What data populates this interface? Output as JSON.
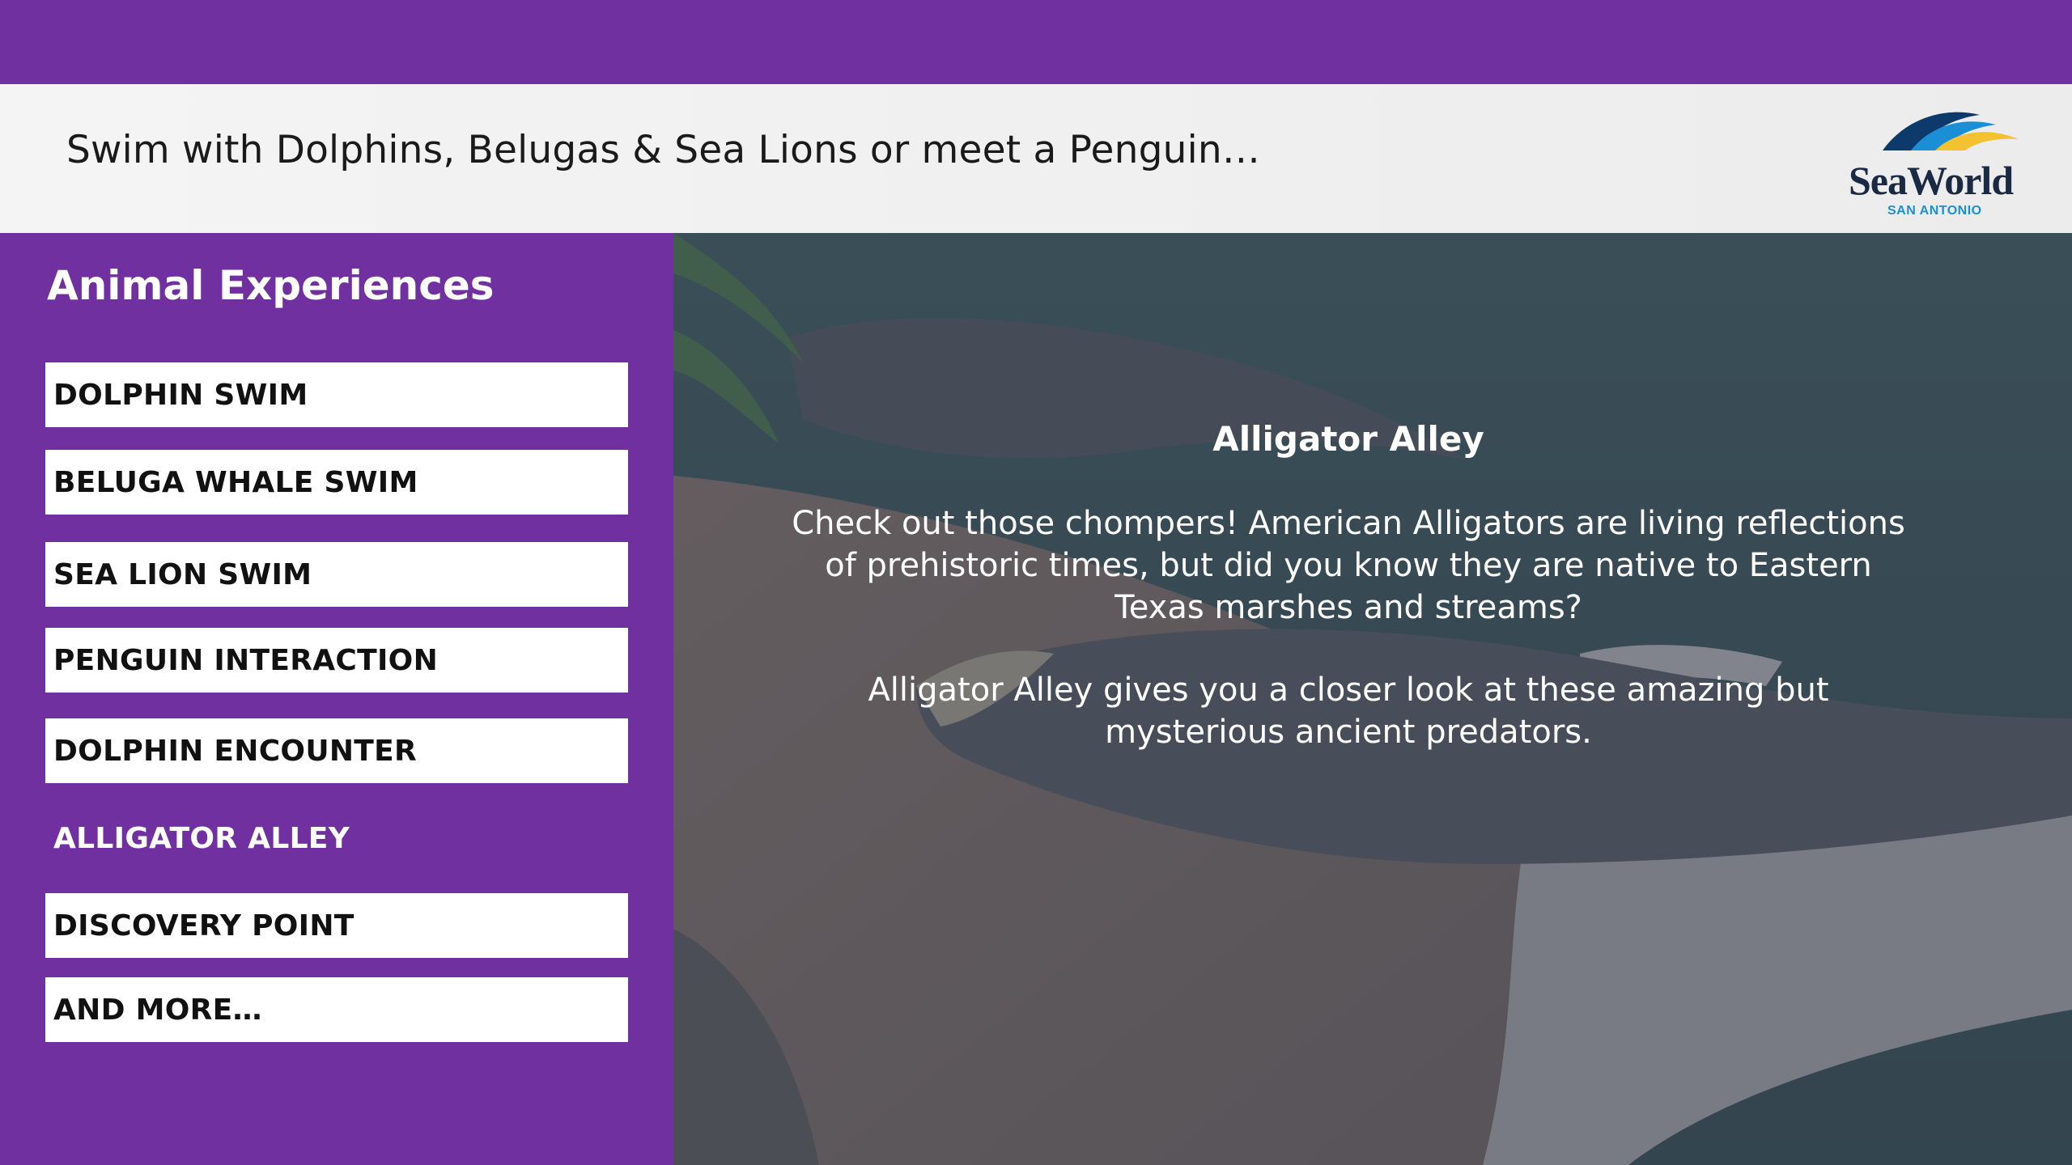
{
  "header": {
    "tagline": "Swim with Dolphins, Belugas & Sea Lions or meet a Penguin…",
    "logo": {
      "brand": "SeaWorld",
      "location": "SAN ANTONIO",
      "icon": "seaworld-wave-logo"
    }
  },
  "sidebar": {
    "title": "Animal Experiences",
    "items": [
      {
        "label": "DOLPHIN SWIM",
        "active": false
      },
      {
        "label": "BELUGA WHALE SWIM",
        "active": false
      },
      {
        "label": "SEA LION SWIM",
        "active": false
      },
      {
        "label": "PENGUIN INTERACTION",
        "active": false
      },
      {
        "label": "DOLPHIN ENCOUNTER",
        "active": false
      },
      {
        "label": "ALLIGATOR ALLEY",
        "active": true
      },
      {
        "label": "DISCOVERY POINT",
        "active": false
      },
      {
        "label": "AND MORE…",
        "active": false
      }
    ]
  },
  "content": {
    "title": "Alligator Alley",
    "paragraphs": [
      "Check out those chompers! American Alligators are living reflections of prehistoric times, but did you know they are native to Eastern Texas marshes and streams?",
      "Alligator Alley gives you a closer look at these amazing but mysterious ancient predators."
    ],
    "background_image": "alligators-on-rocks-photo"
  },
  "colors": {
    "brand_purple": "#7030a0",
    "header_band": "#f0f0f0",
    "menu_item_bg": "#ffffff",
    "overlay": "#465268"
  }
}
